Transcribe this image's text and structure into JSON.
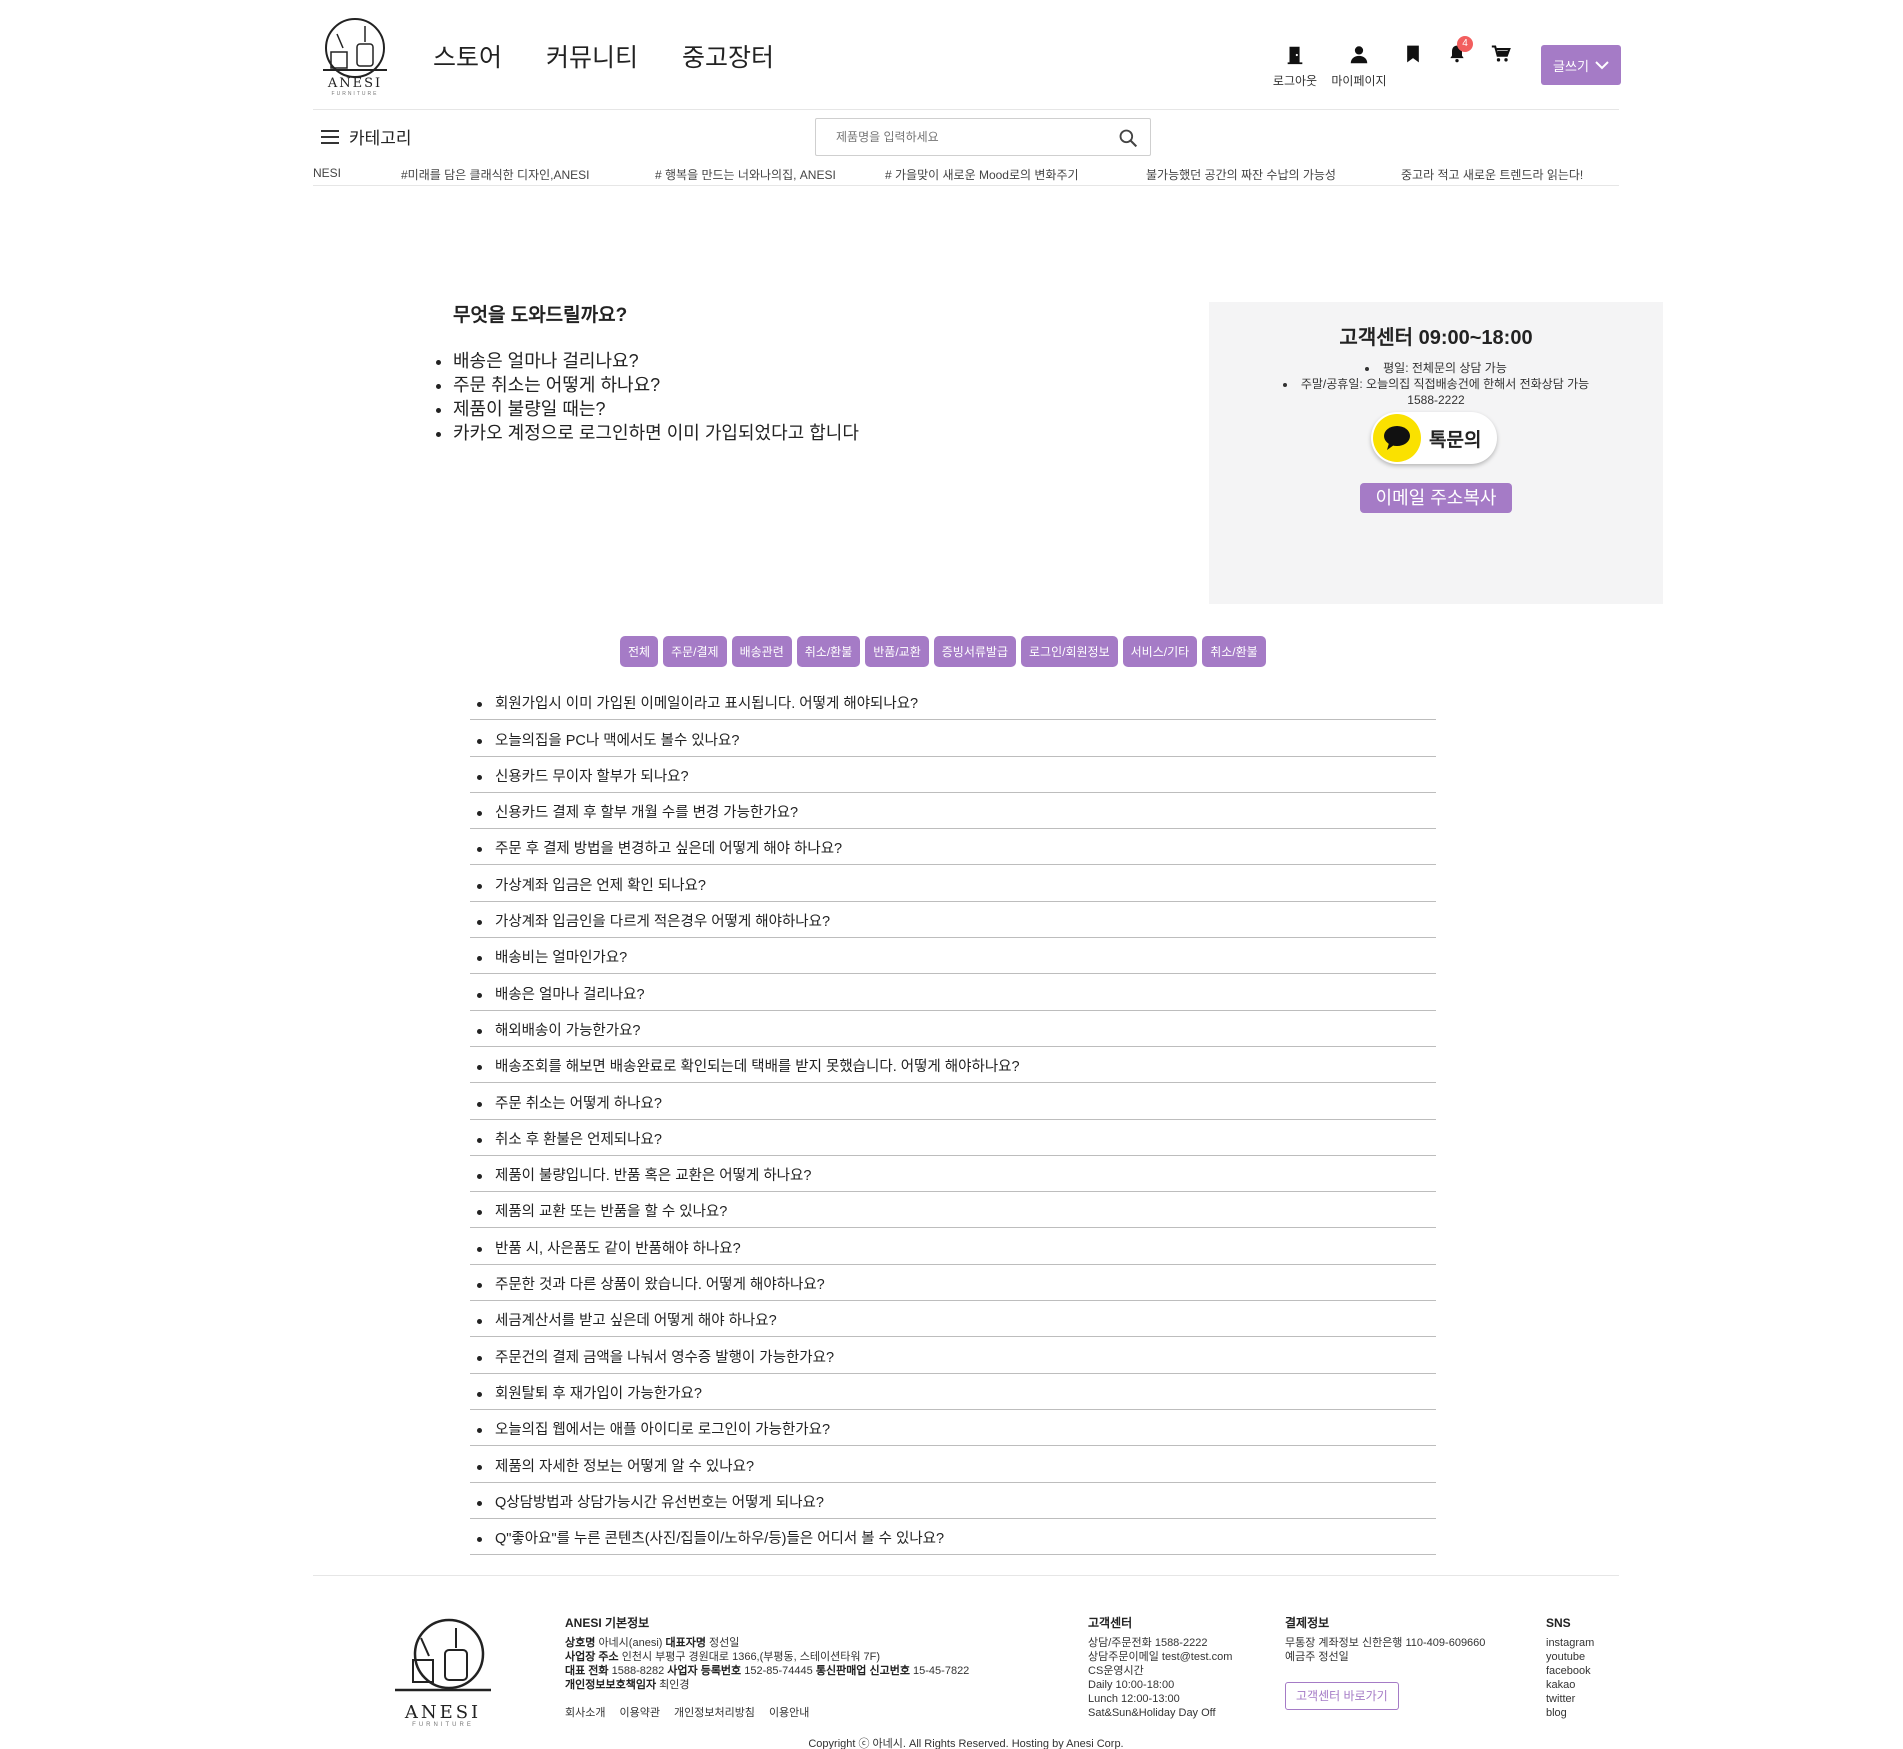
{
  "brand": {
    "name": "ANESI",
    "sub": "FURNITURE"
  },
  "nav": [
    "스토어",
    "커뮤니티",
    "중고장터"
  ],
  "user_menu": {
    "logout": "로그아웃",
    "mypage": "마이페이지",
    "notification_count": "4"
  },
  "write_button": "글쓰기",
  "category_label": "카테고리",
  "search": {
    "placeholder": "제품명을 입력하세요"
  },
  "ticker": [
    "NESI",
    "#미래를 담은 클래식한 디자인,ANESI",
    "# 행복을 만드는 너와나의집, ANESI",
    "# 가을맞이 새로운 Mood로의 변화주기",
    "불가능했던 공간의 짜잔 수납의 가능성",
    "중고라 적고 새로운 트렌드라 읽는다!"
  ],
  "help": {
    "title": "무엇을 도와드릴까요?",
    "items": [
      "배송은 얼마나 걸리나요?",
      "주문 취소는 어떻게 하나요?",
      "제품이 불량일 때는?",
      "카카오 계정으로 로그인하면 이미 가입되었다고 합니다"
    ]
  },
  "cs": {
    "title": "고객센터 09:00~18:00",
    "weekday": "평일: 전체문의 상담 가능",
    "weekend": "주말/공휴일: 오늘의집 직접배송건에 한해서 전화상담 가능",
    "phone": "1588-2222",
    "kakao_label": "톡문의",
    "email_label": "이메일 주소복사"
  },
  "tabs": [
    "전체",
    "주문/결제",
    "배송관련",
    "취소/환불",
    "반품/교환",
    "증빙서류발급",
    "로그인/회원정보",
    "서비스/기타",
    "취소/환불"
  ],
  "faq": [
    "회원가입시 이미 가입된 이메일이라고 표시됩니다. 어떻게 해야되나요?",
    "오늘의집을 PC나 맥에서도 볼수 있나요?",
    "신용카드 무이자 할부가 되나요?",
    "신용카드 결제 후 할부 개월 수를 변경 가능한가요?",
    "주문 후 결제 방법을 변경하고 싶은데 어떻게 해야 하나요?",
    "가상계좌 입금은 언제 확인 되나요?",
    "가상계좌 입금인을 다르게 적은경우 어떻게 해야하나요?",
    "배송비는 얼마인가요?",
    "배송은 얼마나 걸리나요?",
    "해외배송이 가능한가요?",
    "배송조회를 해보면 배송완료로 확인되는데 택배를 받지 못했습니다. 어떻게 해야하나요?",
    "주문 취소는 어떻게 하나요?",
    "취소 후 환불은 언제되나요?",
    "제품이 불량입니다. 반품 혹은 교환은 어떻게 하나요?",
    "제품의 교환 또는 반품을 할 수 있나요?",
    "반품 시, 사은품도 같이 반품해야 하나요?",
    "주문한 것과 다른 상품이 왔습니다. 어떻게 해야하나요?",
    "세금계산서를 받고 싶은데 어떻게 해야 하나요?",
    "주문건의 결제 금액을 나눠서 영수증 발행이 가능한가요?",
    "회원탈퇴 후 재가입이 가능한가요?",
    "오늘의집 웹에서는 애플 아이디로 로그인이 가능한가요?",
    "제품의 자세한 정보는 어떻게 알 수 있나요?",
    "Q상담방법과 상담가능시간 유선번호는 어떻게 되나요?",
    "Q\"좋아요\"를 누른 콘텐츠(사진/집들이/노하우/등)들은 어디서 볼 수 있나요?"
  ],
  "footer": {
    "info_title": "ANESI 기본정보",
    "company_label": "상호명",
    "company": "아네시(anesi)",
    "ceo_label": "대표자명",
    "ceo": "정선일",
    "address_label": "사업장 주소",
    "address": "인천시 부평구 경원대로 1366,(부평동, 스테이션타워 7F)",
    "phone_label": "대표 전화",
    "phone": "1588-8282",
    "bizno_label": "사업자 등록번호",
    "bizno": "152-85-74445",
    "mailorder_label": "통신판매업 신고번호",
    "mailorder": "15-45-7822",
    "privacy_label": "개인정보보호책임자",
    "privacy": "최인경",
    "links": [
      "회사소개",
      "이용약관",
      "개인정보처리방침",
      "이용안내"
    ],
    "cs_title": "고객센터",
    "cs_lines": [
      "상담/주문전화 1588-2222",
      "상담주문이메일 test@test.com",
      "CS운영시간",
      "Daily 10:00-18:00",
      "Lunch 12:00-13:00",
      "Sat&Sun&Holiday Day Off"
    ],
    "pay_title": "결제정보",
    "pay_lines": [
      "무통장 계좌정보 신한은행 110-409-609660",
      "예금주 정선일"
    ],
    "cs_link": "고객센터 바로가기",
    "sns_title": "SNS",
    "sns": [
      "instagram",
      "youtube",
      "facebook",
      "kakao",
      "twitter",
      "blog"
    ],
    "copyright": "Copyright ⓒ 아네시. All Rights Reserved. Hosting by Anesi Corp."
  }
}
